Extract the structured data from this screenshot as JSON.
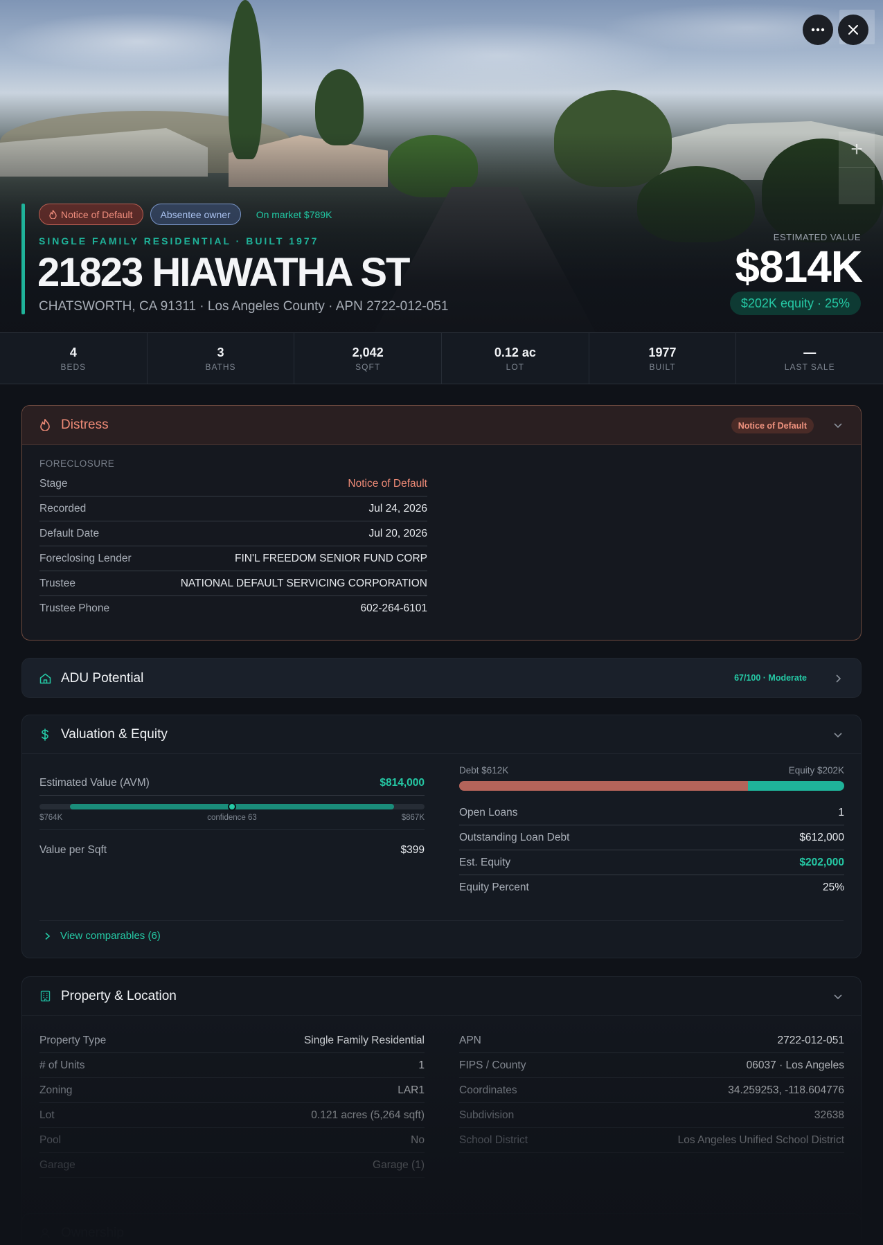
{
  "header": {
    "chips": {
      "notice": "Notice of Default",
      "absentee": "Absentee owner",
      "market": "On market $789K"
    },
    "subtype": "SINGLE FAMILY RESIDENTIAL · BUILT 1977",
    "address": "21823 HIAWATHA ST",
    "location": "CHATSWORTH, CA 91311 · Los Angeles County · APN 2722-012-051",
    "estimated_label": "ESTIMATED VALUE",
    "estimated_value": "$814K",
    "equity_pill": "$202K equity · 25%",
    "icons": {
      "more": "more-icon",
      "close": "close-icon",
      "zoom_in": "plus-icon"
    }
  },
  "stats": [
    {
      "value": "4",
      "label": "BEDS"
    },
    {
      "value": "3",
      "label": "BATHS"
    },
    {
      "value": "2,042",
      "label": "SQFT"
    },
    {
      "value": "0.12 ac",
      "label": "LOT"
    },
    {
      "value": "1977",
      "label": "BUILT"
    },
    {
      "value": "—",
      "label": "LAST SALE"
    }
  ],
  "distress": {
    "title": "Distress",
    "badge": "Notice of Default",
    "section": "FORECLOSURE",
    "rows": [
      {
        "k": "Stage",
        "v": "Notice of Default"
      },
      {
        "k": "Recorded",
        "v": "Jul 24, 2026"
      },
      {
        "k": "Default Date",
        "v": "Jul 20, 2026"
      },
      {
        "k": "Foreclosing Lender",
        "v": "FIN'L FREEDOM SENIOR FUND CORP"
      },
      {
        "k": "Trustee",
        "v": "NATIONAL DEFAULT SERVICING CORPORATION"
      },
      {
        "k": "Trustee Phone",
        "v": "602-264-6101"
      }
    ]
  },
  "adu": {
    "title": "ADU Potential",
    "score": "67/100 · Moderate"
  },
  "valuation": {
    "title": "Valuation & Equity",
    "avm_label": "Estimated Value (AVM)",
    "avm_value": "$814,000",
    "range_low": "$764K",
    "range_high": "$867K",
    "confidence": "confidence 63",
    "avm_position": 0.5,
    "value_per_sqft_label": "Value per Sqft",
    "value_per_sqft": "$399",
    "debt_label": "Debt $612K",
    "equity_label": "Equity $202K",
    "debt_fraction": 0.75,
    "rows": [
      {
        "k": "Open Loans",
        "v": "1"
      },
      {
        "k": "Outstanding Loan Debt",
        "v": "$612,000"
      },
      {
        "k": "Est. Equity",
        "v": "$202,000"
      },
      {
        "k": "Equity Percent",
        "v": "25%"
      }
    ],
    "comparables": "View comparables (6)"
  },
  "property": {
    "title": "Property & Location",
    "left": [
      {
        "k": "Property Type",
        "v": "Single Family Residential"
      },
      {
        "k": "# of Units",
        "v": "1"
      },
      {
        "k": "Zoning",
        "v": "LAR1"
      },
      {
        "k": "Lot",
        "v": "0.121 acres (5,264 sqft)"
      },
      {
        "k": "Pool",
        "v": "No"
      },
      {
        "k": "Garage",
        "v": "Garage (1)"
      }
    ],
    "right": [
      {
        "k": "APN",
        "v": "2722-012-051"
      },
      {
        "k": "FIPS / County",
        "v": "06037 · Los Angeles"
      },
      {
        "k": "Coordinates",
        "v": "34.259253, -118.604776"
      },
      {
        "k": "Subdivision",
        "v": "32638"
      },
      {
        "k": "School District",
        "v": "Los Angeles Unified School District"
      }
    ]
  },
  "ownership": {
    "title": "Ownership"
  },
  "colors": {
    "accent": "#1fb39a",
    "danger": "#ef8b77",
    "debt": "#b4645a"
  }
}
